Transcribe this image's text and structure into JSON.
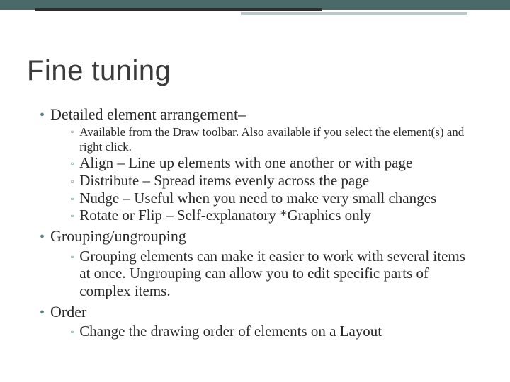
{
  "title": "Fine tuning",
  "sections": [
    {
      "heading": "Detailed element arrangement–",
      "items": [
        {
          "text": "Available from the Draw toolbar.  Also available if you select the element(s) and right click.",
          "small": true
        },
        {
          "text": "Align – Line up elements with one another or with page"
        },
        {
          "text": "Distribute – Spread items evenly across the page"
        },
        {
          "text": "Nudge – Useful when you need to make very small changes"
        },
        {
          "text": "Rotate or Flip – Self-explanatory  *Graphics only"
        }
      ]
    },
    {
      "heading": "Grouping/ungrouping",
      "items": [
        {
          "text": "Grouping elements can make it easier to work with several items at once.  Ungrouping can allow you to edit specific parts of complex items."
        }
      ]
    },
    {
      "heading": "Order",
      "items": [
        {
          "text": "Change the drawing order of elements on a Layout"
        }
      ]
    }
  ]
}
